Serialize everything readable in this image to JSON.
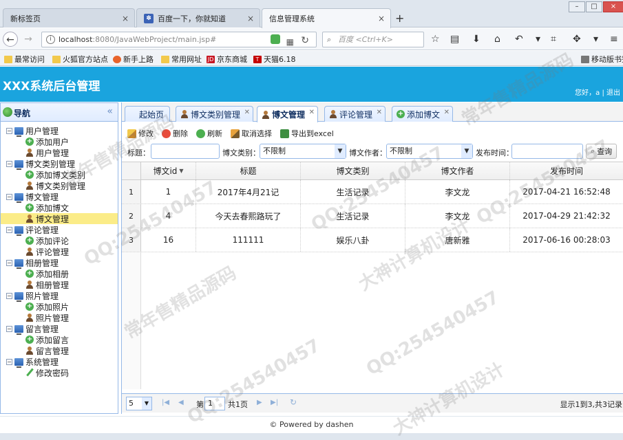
{
  "browser": {
    "tabs": [
      {
        "label": "新标签页"
      },
      {
        "label": "百度一下，你就知道"
      },
      {
        "label": "信息管理系统"
      }
    ],
    "new_tab": "+",
    "url": {
      "host": "localhost",
      "rest": ":8080/JavaWebProject/main.jsp#"
    },
    "search_placeholder": "百度 <Ctrl+K>",
    "bookmarks": [
      "最常访问",
      "火狐官方站点",
      "新手上路",
      "常用网址",
      "京东商城",
      "天猫6.18",
      "移动版书签"
    ]
  },
  "header": {
    "title": "XXX系统后台管理",
    "user_text": "您好，a | 退出"
  },
  "sidebar": {
    "title": "导航",
    "collapse": "«",
    "groups": [
      {
        "label": "用户管理",
        "items": [
          "添加用户",
          "用户管理"
        ]
      },
      {
        "label": "博文类别管理",
        "items": [
          "添加博文类别",
          "博文类别管理"
        ]
      },
      {
        "label": "博文管理",
        "items": [
          "添加博文",
          "博文管理"
        ]
      },
      {
        "label": "评论管理",
        "items": [
          "添加评论",
          "评论管理"
        ]
      },
      {
        "label": "相册管理",
        "items": [
          "添加相册",
          "相册管理"
        ]
      },
      {
        "label": "照片管理",
        "items": [
          "添加照片",
          "照片管理"
        ]
      },
      {
        "label": "留言管理",
        "items": [
          "添加留言",
          "留言管理"
        ]
      },
      {
        "label": "系统管理",
        "items": [
          "修改密码"
        ]
      }
    ]
  },
  "main_tabs": [
    {
      "label": "起始页"
    },
    {
      "label": "博文类别管理"
    },
    {
      "label": "博文管理"
    },
    {
      "label": "评论管理"
    },
    {
      "label": "添加博文"
    }
  ],
  "toolbar": {
    "edit": "修改",
    "delete": "删除",
    "refresh": "刷新",
    "cancel_select": "取消选择",
    "export": "导出到excel"
  },
  "filter": {
    "title_label": "标题：",
    "category_label": "博文类别：",
    "category_value": "不限制",
    "author_label": "博文作者：",
    "author_value": "不限制",
    "time_label": "发布时间：",
    "query": "查询"
  },
  "table": {
    "columns": [
      "博文id",
      "标题",
      "博文类别",
      "博文作者",
      "发布时间"
    ],
    "rows": [
      {
        "num": "1",
        "id": "1",
        "title": "2017年4月21记",
        "category": "生活记录",
        "author": "李文龙",
        "time": "2017-04-21 16:52:48"
      },
      {
        "num": "2",
        "id": "4",
        "title": "今天去春熙路玩了",
        "category": "生活记录",
        "author": "李文龙",
        "time": "2017-04-29 21:42:32"
      },
      {
        "num": "3",
        "id": "16",
        "title": "111111",
        "category": "娱乐八卦",
        "author": "唐新雅",
        "time": "2017-06-16 00:28:03"
      }
    ]
  },
  "pager": {
    "page_size": "5",
    "page_prefix": "第",
    "page": "1",
    "page_total": "共1页",
    "summary": "显示1到3,共3记录"
  },
  "footer": "© Powered by dashen",
  "watermarks": [
    "QQ:254540457",
    "大神计算机设计",
    "常年售精品源码"
  ]
}
